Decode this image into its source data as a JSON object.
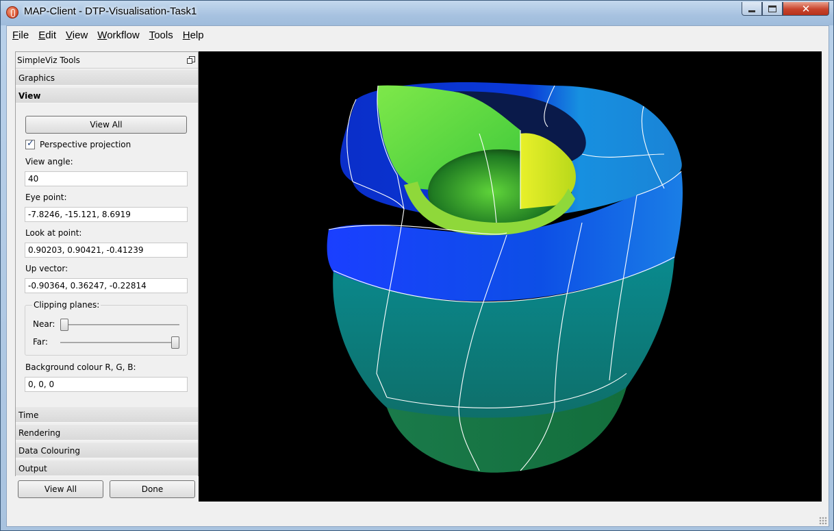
{
  "window": {
    "title": "MAP-Client - DTP-Visualisation-Task1"
  },
  "menu": [
    "File",
    "Edit",
    "View",
    "Workflow",
    "Tools",
    "Help"
  ],
  "panel": {
    "title": "SimpleViz Tools",
    "sections_top": [
      "Graphics",
      "View"
    ],
    "sections_bottom": [
      "Time",
      "Rendering",
      "Data Colouring",
      "Output"
    ],
    "view": {
      "view_all_label": "View All",
      "perspective_label": "Perspective projection",
      "perspective_checked": true,
      "view_angle_label": "View angle:",
      "view_angle": "40",
      "eye_point_label": "Eye point:",
      "eye_point": "-7.8246, -15.121, 8.6919",
      "look_at_label": "Look at point:",
      "look_at": "0.90203, 0.90421, -0.41239",
      "up_vector_label": "Up vector:",
      "up_vector": "-0.90364, 0.36247, -0.22814",
      "clipping_label": "Clipping planes:",
      "near_label": "Near:",
      "near_value": 0.0,
      "far_label": "Far:",
      "far_value": 1.0,
      "bg_label": "Background colour R, G, B:",
      "bg_value": "0, 0, 0"
    }
  },
  "buttons": {
    "view_all": "View All",
    "done": "Done"
  },
  "colors": {
    "viewport_bg": "#000000",
    "mesh_line": "#ffffff"
  }
}
